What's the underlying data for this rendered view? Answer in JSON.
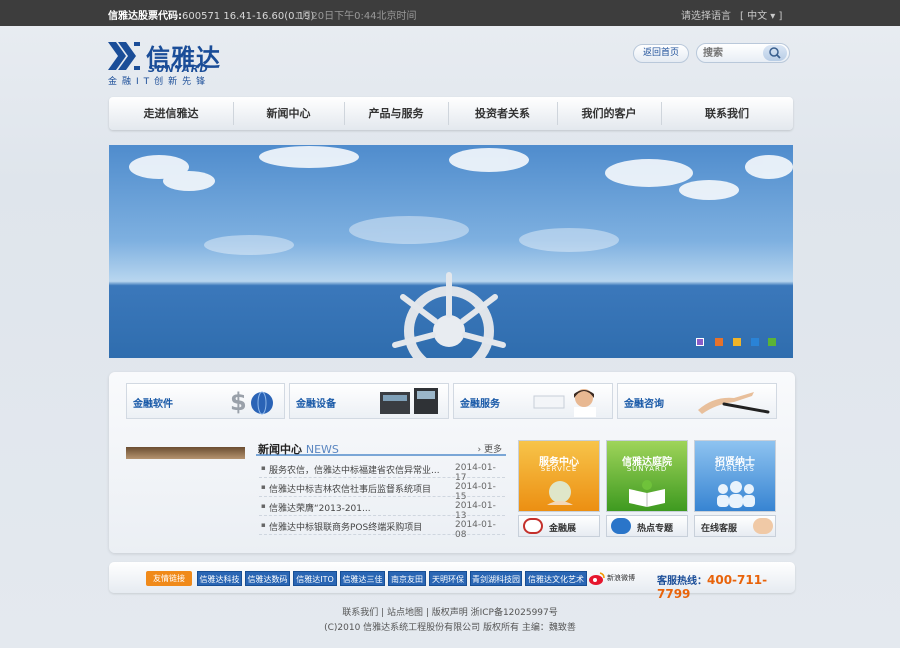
{
  "topbar": {
    "stock_label": "信雅达股票代码:",
    "stock_value": "600571 16.41-16.60(0.19)",
    "time": "1月20日下午0:44北京时间",
    "lang_label": "请选择语言",
    "lang_selected": "[ 中文 ▾ ]"
  },
  "logo": {
    "cn": "信雅达",
    "en": "SUNYARD",
    "slogan": "金融IT创新先锋"
  },
  "header": {
    "home_button": "返回首页",
    "search_placeholder": "搜索"
  },
  "nav": {
    "items": [
      "走进信雅达",
      "新闻中心",
      "产品与服务",
      "投资者关系",
      "我们的客户",
      "联系我们"
    ]
  },
  "banner": {
    "dots": [
      {
        "color": "#8a5cc8",
        "active": true
      },
      {
        "color": "#e7722b",
        "active": false
      },
      {
        "color": "#f0b429",
        "active": false
      },
      {
        "color": "#2a83d6",
        "active": false
      },
      {
        "color": "#5bb336",
        "active": false
      }
    ]
  },
  "categories": [
    {
      "label": "金融软件",
      "icon": "dollar-globe-icon"
    },
    {
      "label": "金融设备",
      "icon": "pos-terminal-icon"
    },
    {
      "label": "金融服务",
      "icon": "service-woman-icon"
    },
    {
      "label": "金融咨询",
      "icon": "pen-icon"
    }
  ],
  "news": {
    "title": "新闻中心",
    "title_en": "NEWS",
    "more": "更多",
    "items": [
      {
        "title": "服务农信，信雅达中标福建省农信异常业...",
        "date": "2014-01-17"
      },
      {
        "title": "信雅达中标吉林农信社事后监督系统项目",
        "date": "2014-01-15"
      },
      {
        "title": "信雅达荣膺“2013-201...",
        "date": "2014-01-13"
      },
      {
        "title": "信雅达中标银联商务POS终端采购项目",
        "date": "2014-01-08"
      }
    ]
  },
  "tiles": [
    {
      "cn": "服务中心",
      "en": "SERVICE",
      "color_top": "#f7c44a",
      "color_bottom": "#ec8f12"
    },
    {
      "cn": "信雅达庭院",
      "en": "SUNYARD",
      "color_top": "#9fd45a",
      "color_bottom": "#3e9a20"
    },
    {
      "cn": "招贤纳士",
      "en": "CAREERS",
      "color_top": "#8ec3f0",
      "color_bottom": "#3784d2"
    }
  ],
  "sub_buttons": [
    {
      "label": "金融展",
      "icon": "exhibition-icon"
    },
    {
      "label": "热点专题",
      "icon": "hot-topic-icon"
    },
    {
      "label": "在线客服",
      "icon": "customer-service-icon"
    }
  ],
  "links": {
    "tag": "友情链接",
    "items": [
      "信雅达科技",
      "信雅达数码",
      "信雅达ITO",
      "信雅达三佳",
      "南京友田",
      "天明环保",
      "青剑湖科技园",
      "信雅达文化艺术"
    ],
    "weibo": "新浪微博",
    "hotline_label": "客服热线：",
    "hotline_number": "400-711-7799"
  },
  "footer": {
    "line1": "联系我们 | 站点地图 | 版权声明 浙ICP备12025997号",
    "line2": "(C)2010 信雅达系统工程股份有限公司 版权所有 主编：魏致善"
  }
}
